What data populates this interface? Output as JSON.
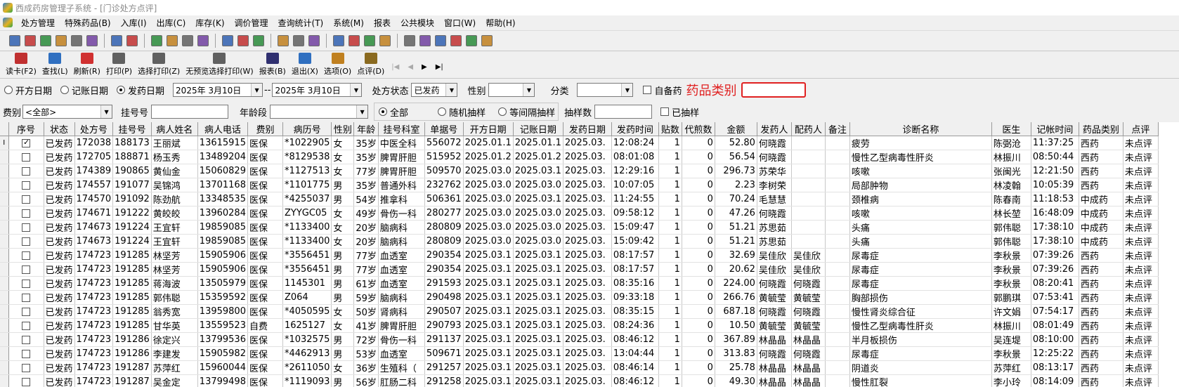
{
  "window": {
    "title": "西成药房管理子系统 - [门诊处方点评]"
  },
  "menu": [
    "处方管理",
    "特殊药品(B)",
    "入库(I)",
    "出库(C)",
    "库存(K)",
    "调价管理",
    "查询统计(T)",
    "系统(M)",
    "报表",
    "公共模块",
    "窗口(W)",
    "帮助(H)"
  ],
  "icon_toolbar": [
    "prescription-icon",
    "bottle-icon",
    "mail-icon",
    "gift-icon",
    "binoculars-icon",
    "scale-icon",
    "|",
    "invoice-icon",
    "folder-icon",
    "|",
    "document-icon",
    "checklist-icon",
    "edit-icon",
    "refresh-doc-icon",
    "|",
    "calculator-icon",
    "bell-icon",
    "chart-icon",
    "|",
    "trash-icon",
    "transfer-icon",
    "truck-icon",
    "|",
    "bag-icon",
    "thermometer-icon",
    "search-icon",
    "settings-icon",
    "|",
    "lock-icon",
    "globe-icon",
    "window-icon",
    "cascade-icon",
    "tile-icon",
    "exit-icon"
  ],
  "actions": [
    {
      "label": "读卡(F2)",
      "icon": "card-reader-icon",
      "color": "#c03030"
    },
    {
      "label": "查找(L)",
      "icon": "find-icon",
      "color": "#2f6fc0"
    },
    {
      "label": "刷新(R)",
      "icon": "refresh-icon",
      "color": "#d03030"
    },
    {
      "label": "打印(P)",
      "icon": "print-icon",
      "color": "#606060"
    },
    {
      "label": "选择打印(Z)",
      "icon": "print-select-icon",
      "color": "#606060"
    },
    {
      "label": "无预览选择打印(W)",
      "icon": "print-no-preview-icon",
      "color": "#606060"
    },
    {
      "label": "报表(B)",
      "icon": "save-report-icon",
      "color": "#303070"
    },
    {
      "label": "退出(X)",
      "icon": "exit-door-icon",
      "color": "#2f6fc0"
    },
    {
      "label": "选项(O)",
      "icon": "options-icon",
      "color": "#c08020"
    },
    {
      "label": "点评(D)",
      "icon": "review-icon",
      "color": "#8a6a20"
    }
  ],
  "nav": [
    "|◀",
    "◀",
    "▶",
    "▶|"
  ],
  "filters": {
    "date_types": [
      "开方日期",
      "记账日期",
      "发药日期"
    ],
    "date_type_selected": 2,
    "date_from": "2025年 3月10日",
    "date_sep": "--",
    "date_to": "2025年 3月10日",
    "status_label": "处方状态",
    "status_value": "已发药",
    "gender_label": "性别",
    "gender_value": "",
    "category_label": "分类",
    "category_value": "",
    "self_drug_label": "自备药",
    "drug_category_label": "药品类别",
    "fee_label": "费别",
    "fee_value": "<全部>",
    "reg_label": "挂号号",
    "reg_value": "",
    "age_label": "年龄段",
    "age_value": "",
    "sample_options": [
      "全部",
      "随机抽样",
      "等间隔抽样"
    ],
    "sample_selected": 0,
    "sample_count_label": "抽样数",
    "sample_count_value": "",
    "sampled_label": "已抽样"
  },
  "table": {
    "columns": [
      "序号",
      "状态",
      "处方号",
      "挂号号",
      "病人姓名",
      "病人电话",
      "费别",
      "病历号",
      "性别",
      "年龄",
      "挂号科室",
      "单据号",
      "开方日期",
      "记账日期",
      "发药日期",
      "发药时间",
      "贴数",
      "代煎数",
      "金额",
      "发药人",
      "配药人",
      "备注",
      "诊断名称",
      "医生",
      "记帐时间",
      "药品类别",
      "点评"
    ],
    "rows": [
      [
        "已发药",
        "172038",
        "188173",
        "王丽斌",
        "13615915",
        "医保",
        "*1022905",
        "女",
        "35岁",
        "中医全科",
        "556072",
        "2025.01.1",
        "2025.01.1",
        "2025.03.",
        "12:08:24",
        "1",
        "0",
        "52.80",
        "何晓霞",
        "",
        "",
        "疲劳",
        "陈弼沧",
        "11:37:25",
        "西药",
        "未点评"
      ],
      [
        "已发药",
        "172705",
        "188871",
        "杨玉秀",
        "13489204",
        "医保",
        "*8129538",
        "女",
        "35岁",
        "脾胃肝胆",
        "515952",
        "2025.01.2",
        "2025.01.2",
        "2025.03.",
        "08:01:08",
        "1",
        "0",
        "56.54",
        "何晓霞",
        "",
        "",
        "慢性乙型病毒性肝炎",
        "林振川",
        "08:50:44",
        "西药",
        "未点评"
      ],
      [
        "已发药",
        "174389",
        "190865",
        "黄仙金",
        "15060829",
        "医保",
        "*1127513",
        "女",
        "77岁",
        "脾胃肝胆",
        "509570",
        "2025.03.0",
        "2025.03.1",
        "2025.03.",
        "12:29:16",
        "1",
        "0",
        "296.73",
        "苏荣华",
        "",
        "",
        "咳嗽",
        "张闽光",
        "12:21:50",
        "西药",
        "未点评"
      ],
      [
        "已发药",
        "174557",
        "191077",
        "吴锦鸿",
        "13701168",
        "医保",
        "*1101775",
        "男",
        "35岁",
        "普通外科",
        "232762",
        "2025.03.0",
        "2025.03.0",
        "2025.03.",
        "10:07:05",
        "1",
        "0",
        "2.23",
        "李树荣",
        "",
        "",
        "局部肿物",
        "林凌翰",
        "10:05:39",
        "西药",
        "未点评"
      ],
      [
        "已发药",
        "174570",
        "191092",
        "陈劲航",
        "13348535",
        "医保",
        "*4255037",
        "男",
        "54岁",
        "推拿科",
        "506361",
        "2025.03.0",
        "2025.03.1",
        "2025.03.",
        "11:24:55",
        "1",
        "0",
        "70.24",
        "毛慧慧",
        "",
        "",
        "颈椎病",
        "陈春南",
        "11:18:53",
        "中成药",
        "未点评"
      ],
      [
        "已发药",
        "174671",
        "191222",
        "黄皎皎",
        "13960284",
        "医保",
        "ZYYGC05",
        "女",
        "49岁",
        "骨伤一科",
        "280277",
        "2025.03.0",
        "2025.03.0",
        "2025.03.",
        "09:58:12",
        "1",
        "0",
        "47.26",
        "何晓霞",
        "",
        "",
        "咳嗽",
        "林长堃",
        "16:48:09",
        "中成药",
        "未点评"
      ],
      [
        "已发药",
        "174673",
        "191224",
        "王宜轩",
        "19859085",
        "医保",
        "*1133400",
        "女",
        "20岁",
        "脑病科",
        "280809",
        "2025.03.0",
        "2025.03.0",
        "2025.03.",
        "15:09:47",
        "1",
        "0",
        "51.21",
        "苏思茹",
        "",
        "",
        "头痛",
        "郭伟聪",
        "17:38:10",
        "中成药",
        "未点评"
      ],
      [
        "已发药",
        "174673",
        "191224",
        "王宜轩",
        "19859085",
        "医保",
        "*1133400",
        "女",
        "20岁",
        "脑病科",
        "280809",
        "2025.03.0",
        "2025.03.0",
        "2025.03.",
        "15:09:42",
        "1",
        "0",
        "51.21",
        "苏思茹",
        "",
        "",
        "头痛",
        "郭伟聪",
        "17:38:10",
        "中成药",
        "未点评"
      ],
      [
        "已发药",
        "174723",
        "191285",
        "林坚芳",
        "15905906",
        "医保",
        "*3556451",
        "男",
        "77岁",
        "血透室",
        "290354",
        "2025.03.1",
        "2025.03.1",
        "2025.03.",
        "08:17:57",
        "1",
        "0",
        "32.69",
        "吴佳欣",
        "吴佳欣",
        "",
        "尿毒症",
        "李秋景",
        "07:39:26",
        "西药",
        "未点评"
      ],
      [
        "已发药",
        "174723",
        "191285",
        "林坚芳",
        "15905906",
        "医保",
        "*3556451",
        "男",
        "77岁",
        "血透室",
        "290354",
        "2025.03.1",
        "2025.03.1",
        "2025.03.",
        "08:17:57",
        "1",
        "0",
        "20.62",
        "吴佳欣",
        "吴佳欣",
        "",
        "尿毒症",
        "李秋景",
        "07:39:26",
        "西药",
        "未点评"
      ],
      [
        "已发药",
        "174723",
        "191285",
        "蒋海波",
        "13505979",
        "医保",
        "1145301",
        "男",
        "61岁",
        "血透室",
        "291593",
        "2025.03.1",
        "2025.03.1",
        "2025.03.",
        "08:35:16",
        "1",
        "0",
        "224.00",
        "何晓霞",
        "何晓霞",
        "",
        "尿毒症",
        "李秋景",
        "08:20:41",
        "西药",
        "未点评"
      ],
      [
        "已发药",
        "174723",
        "191285",
        "郭伟聪",
        "15359592",
        "医保",
        "Z064",
        "男",
        "59岁",
        "脑病科",
        "290498",
        "2025.03.1",
        "2025.03.1",
        "2025.03.",
        "09:33:18",
        "1",
        "0",
        "266.76",
        "黄毓莹",
        "黄毓莹",
        "",
        "胸部损伤",
        "郭鹏琪",
        "07:53:41",
        "西药",
        "未点评"
      ],
      [
        "已发药",
        "174723",
        "191285",
        "翁秀宽",
        "13959800",
        "医保",
        "*4050595",
        "女",
        "50岁",
        "肾病科",
        "290507",
        "2025.03.1",
        "2025.03.1",
        "2025.03.",
        "08:35:15",
        "1",
        "0",
        "687.18",
        "何晓霞",
        "何晓霞",
        "",
        "慢性肾炎综合征",
        "许文娟",
        "07:54:17",
        "西药",
        "未点评"
      ],
      [
        "已发药",
        "174723",
        "191285",
        "甘华英",
        "13559523",
        "自费",
        "1625127",
        "女",
        "41岁",
        "脾胃肝胆",
        "290793",
        "2025.03.1",
        "2025.03.1",
        "2025.03.",
        "08:24:36",
        "1",
        "0",
        "10.50",
        "黄毓莹",
        "黄毓莹",
        "",
        "慢性乙型病毒性肝炎",
        "林振川",
        "08:01:49",
        "西药",
        "未点评"
      ],
      [
        "已发药",
        "174723",
        "191286",
        "徐定兴",
        "13799536",
        "医保",
        "*1032575",
        "男",
        "72岁",
        "骨伤一科",
        "291137",
        "2025.03.1",
        "2025.03.1",
        "2025.03.",
        "08:46:12",
        "1",
        "0",
        "367.89",
        "林晶晶",
        "林晶晶",
        "",
        "半月板损伤",
        "吴连堤",
        "08:10:00",
        "西药",
        "未点评"
      ],
      [
        "已发药",
        "174723",
        "191286",
        "李建发",
        "15905982",
        "医保",
        "*4462913",
        "男",
        "53岁",
        "血透室",
        "509671",
        "2025.03.1",
        "2025.03.1",
        "2025.03.",
        "13:04:44",
        "1",
        "0",
        "313.83",
        "何晓霞",
        "何晓霞",
        "",
        "尿毒症",
        "李秋景",
        "12:25:22",
        "西药",
        "未点评"
      ],
      [
        "已发药",
        "174723",
        "191287",
        "苏萍红",
        "15960044",
        "医保",
        "*2611050",
        "女",
        "36岁",
        "生殖科（",
        "291257",
        "2025.03.1",
        "2025.03.1",
        "2025.03.",
        "08:46:14",
        "1",
        "0",
        "25.78",
        "林晶晶",
        "林晶晶",
        "",
        "阴道炎",
        "苏萍红",
        "08:13:17",
        "西药",
        "未点评"
      ],
      [
        "已发药",
        "174723",
        "191287",
        "吴金定",
        "13799498",
        "医保",
        "*1119093",
        "男",
        "56岁",
        "肛肠二科",
        "291258",
        "2025.03.1",
        "2025.03.1",
        "2025.03.",
        "08:46:12",
        "1",
        "0",
        "49.30",
        "林晶晶",
        "林晶晶",
        "",
        "慢性肛裂",
        "李小玲",
        "08:14:09",
        "西药",
        "未点评"
      ]
    ],
    "checked_rows": [
      0
    ]
  }
}
